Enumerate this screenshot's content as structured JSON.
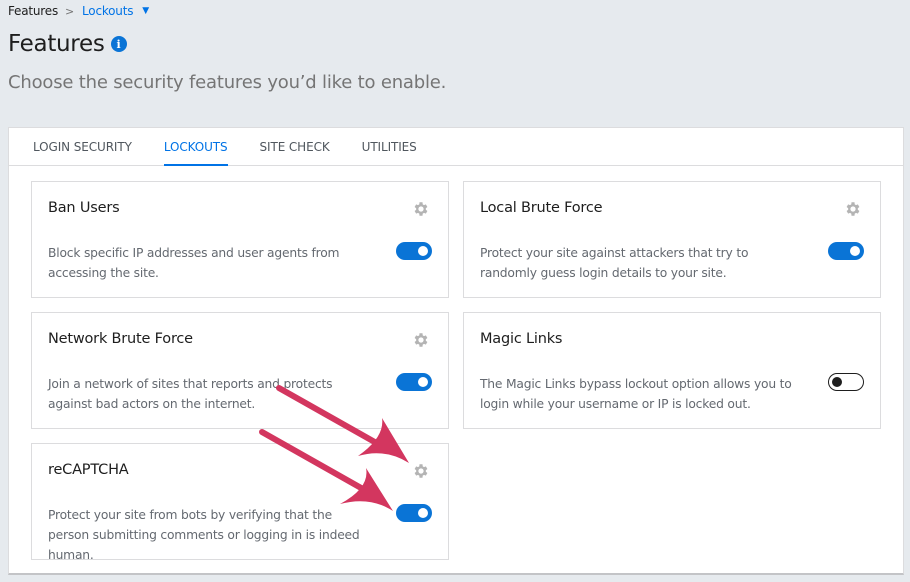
{
  "breadcrumb": {
    "root": "Features",
    "separator": ">",
    "current": "Lockouts",
    "caret": "▼"
  },
  "header": {
    "title": "Features",
    "info_icon": "i",
    "subtitle": "Choose the security features you’d like to enable."
  },
  "tabs": [
    {
      "label": "Login Security",
      "active": false
    },
    {
      "label": "Lockouts",
      "active": true
    },
    {
      "label": "Site Check",
      "active": false
    },
    {
      "label": "Utilities",
      "active": false
    }
  ],
  "cards": [
    {
      "title": "Ban Users",
      "description": "Block specific IP addresses and user agents from accessing the site.",
      "enabled": true,
      "has_settings": true
    },
    {
      "title": "Local Brute Force",
      "description": "Protect your site against attackers that try to randomly guess login details to your site.",
      "enabled": true,
      "has_settings": true
    },
    {
      "title": "Network Brute Force",
      "description": "Join a network of sites that reports and protects against bad actors on the internet.",
      "enabled": true,
      "has_settings": true
    },
    {
      "title": "Magic Links",
      "description": "The Magic Links bypass lockout option allows you to login while your username or IP is locked out.",
      "enabled": false,
      "has_settings": false
    },
    {
      "title": "reCAPTCHA",
      "description": "Protect your site from bots by verifying that the person submitting comments or logging in is indeed human.",
      "enabled": true,
      "has_settings": true
    }
  ],
  "colors": {
    "accent": "#0073e6",
    "toggle_on": "#0a74d6",
    "annotation_arrow": "#d3365f",
    "gear": "#b4b4b4"
  },
  "annotations": [
    {
      "type": "arrow",
      "points_to": "reCAPTCHA settings gear"
    },
    {
      "type": "arrow",
      "points_to": "reCAPTCHA toggle"
    }
  ]
}
